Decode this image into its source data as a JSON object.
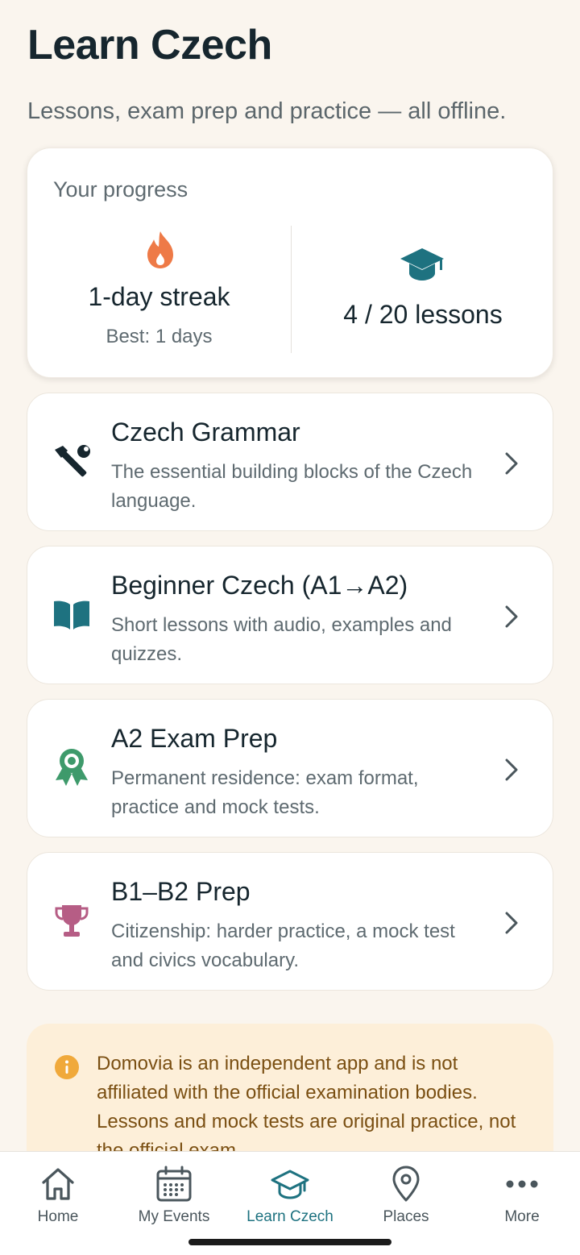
{
  "header": {
    "title": "Learn Czech",
    "subtitle": "Lessons, exam prep and practice — all offline."
  },
  "progress": {
    "heading": "Your progress",
    "streak_value": "1-day streak",
    "streak_best": "Best: 1 days",
    "lessons_value": "4 / 20 lessons",
    "icons": {
      "streak": "fire-icon",
      "lessons": "graduation-cap-icon"
    }
  },
  "courses": [
    {
      "title": "Czech Grammar",
      "description": "The essential building blocks of the Czech language.",
      "icon": "tools-icon",
      "icon_color": "#16262E"
    },
    {
      "title": "Beginner Czech (A1→A2)",
      "description": "Short lessons with audio, examples and quizzes.",
      "icon": "book-icon",
      "icon_color": "#1E7280"
    },
    {
      "title": "A2 Exam Prep",
      "description": "Permanent residence: exam format, practice and mock tests.",
      "icon": "award-icon",
      "icon_color": "#3E9A6B"
    },
    {
      "title": "B1–B2 Prep",
      "description": "Citizenship: harder practice, a mock test and civics vocabulary.",
      "icon": "trophy-icon",
      "icon_color": "#B65D85"
    }
  ],
  "notice": {
    "text": "Domovia is an independent app and is not affiliated with the official examination bodies. Lessons and mock tests are original practice, not the official exam.",
    "icon": "info-icon",
    "icon_color": "#F0A93B"
  },
  "nav": {
    "items": [
      {
        "label": "Home",
        "icon": "home-icon"
      },
      {
        "label": "My Events",
        "icon": "calendar-icon"
      },
      {
        "label": "Learn Czech",
        "icon": "graduation-cap-icon",
        "active": true
      },
      {
        "label": "Places",
        "icon": "location-pin-icon"
      },
      {
        "label": "More",
        "icon": "more-dots-icon"
      }
    ]
  },
  "colors": {
    "background": "#FAF5EE",
    "accent": "#1E7280",
    "fire": "#EE7A47",
    "notice_bg": "#FDEFD9"
  }
}
